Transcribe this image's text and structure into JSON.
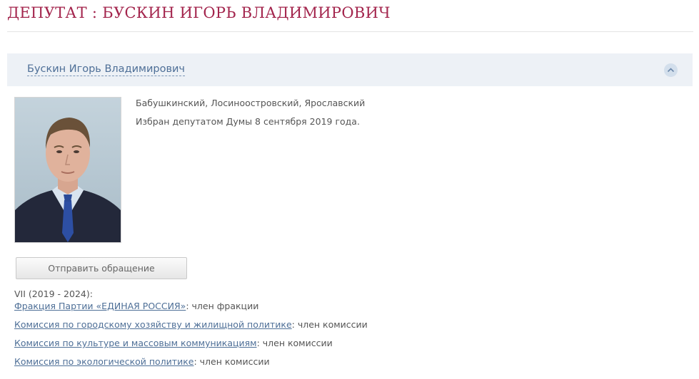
{
  "page": {
    "title": "ДЕПУТАТ : БУСКИН ИГОРЬ ВЛАДИМИРОВИЧ"
  },
  "deputy": {
    "name": "Бускин Игорь Владимирович",
    "districts": "Бабушкинский, Лосиноостровский, Ярославский",
    "elected": "Избран депутатом Думы 8 сентября 2019 года.",
    "send_button": "Отправить обращение",
    "convocation": "VII (2019 - 2024):",
    "memberships": [
      {
        "link": "Фракция Партии «ЕДИНАЯ РОССИЯ»",
        "role": ": член фракции"
      },
      {
        "link": "Комиссия по городскому хозяйству и жилищной политике",
        "role": ": член комиссии"
      },
      {
        "link": "Комиссия по культуре и массовым коммуникациям",
        "role": ": член комиссии"
      },
      {
        "link": "Комиссия по экологической политике",
        "role": ": член комиссии"
      }
    ]
  },
  "icons": {
    "collapse": "chevron-up-icon",
    "photo": "deputy-portrait"
  },
  "colors": {
    "title": "#a3254d",
    "link": "#4e6f97",
    "accordion_bg": "#edf1f6"
  }
}
